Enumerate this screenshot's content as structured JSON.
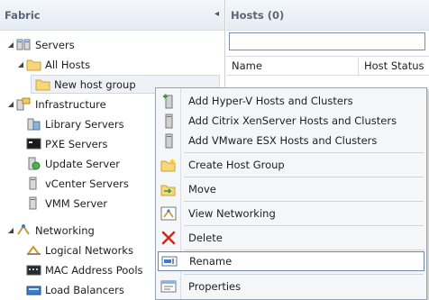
{
  "fabric": {
    "title": "Fabric",
    "collapse_glyph": "◂",
    "tree": [
      {
        "label": "Servers",
        "expander": "◢",
        "icon": "servers-icon"
      },
      {
        "label": "All Hosts",
        "expander": "◢",
        "icon": "folder-icon"
      },
      {
        "label": "New host group",
        "expander": "",
        "icon": "folder-icon",
        "selected": true
      },
      {
        "label": "Infrastructure",
        "expander": "◢",
        "icon": "infrastructure-icon"
      },
      {
        "label": "Library Servers",
        "expander": "",
        "icon": "library-server-icon"
      },
      {
        "label": "PXE Servers",
        "expander": "",
        "icon": "pxe-server-icon"
      },
      {
        "label": "Update Server",
        "expander": "",
        "icon": "update-server-icon"
      },
      {
        "label": "vCenter Servers",
        "expander": "",
        "icon": "vcenter-server-icon"
      },
      {
        "label": "VMM Server",
        "expander": "",
        "icon": "vmm-server-icon"
      },
      {
        "label": "Networking",
        "expander": "◢",
        "icon": "networking-icon"
      },
      {
        "label": "Logical Networks",
        "expander": "",
        "icon": "logical-networks-icon"
      },
      {
        "label": "MAC Address Pools",
        "expander": "",
        "icon": "mac-pool-icon"
      },
      {
        "label": "Load Balancers",
        "expander": "",
        "icon": "load-balancer-icon"
      }
    ]
  },
  "hosts": {
    "title": "Hosts (0)",
    "search_value": "",
    "columns": [
      "Name",
      "Host Status"
    ]
  },
  "context_menu": {
    "items": [
      {
        "label": "Add Hyper-V Hosts and Clusters",
        "icon": "hyperv-host-icon"
      },
      {
        "label": "Add Citrix XenServer Hosts and Clusters",
        "icon": "xenserver-host-icon"
      },
      {
        "label": "Add VMware ESX Hosts and Clusters",
        "icon": "vmware-host-icon"
      },
      {
        "label": "Create Host Group",
        "icon": "create-folder-icon"
      },
      {
        "label": "Move",
        "icon": "move-icon"
      },
      {
        "label": "View Networking",
        "icon": "view-networking-icon"
      },
      {
        "label": "Delete",
        "icon": "delete-icon"
      },
      {
        "label": "Rename",
        "icon": "rename-icon",
        "highlighted": true
      },
      {
        "label": "Properties",
        "icon": "properties-icon"
      }
    ]
  }
}
